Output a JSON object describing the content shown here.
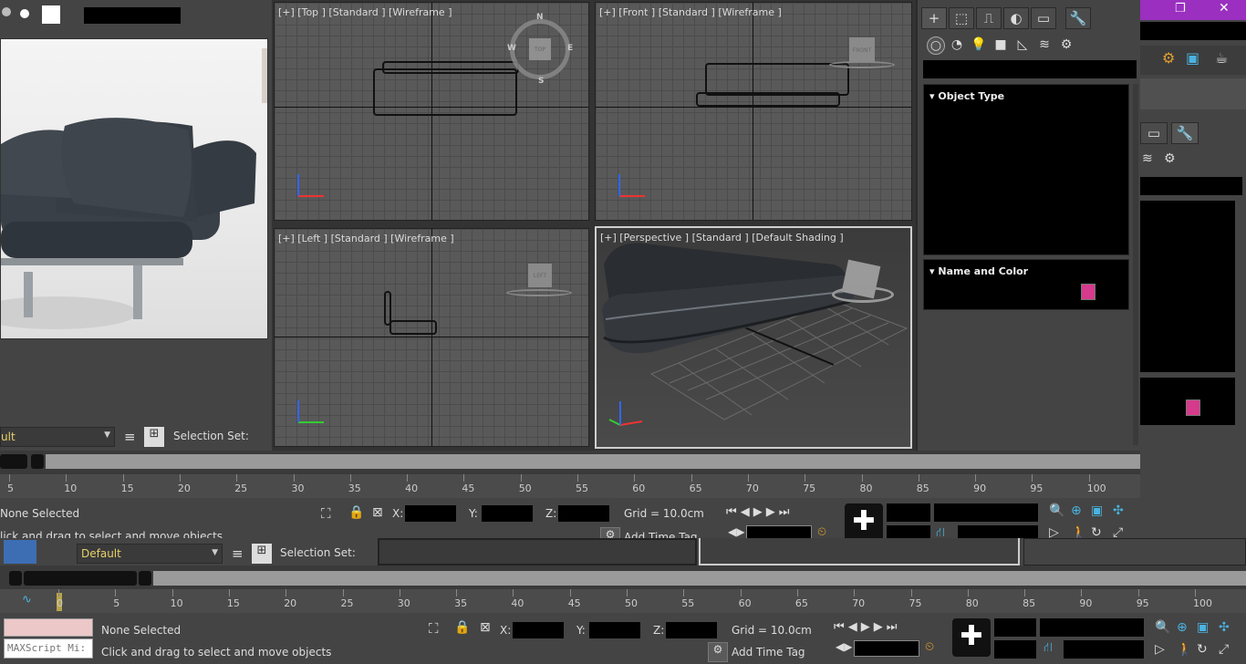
{
  "window": {
    "restore_label": "❐",
    "close_label": "✕"
  },
  "viewports": {
    "top": {
      "label": "[+] [Top ] [Standard ] [Wireframe ]",
      "nav": {
        "n": "N",
        "s": "S",
        "e": "E",
        "w": "W",
        "face": "TOP"
      }
    },
    "front": {
      "label": "[+] [Front ] [Standard ] [Wireframe ]",
      "cube": "FRONT"
    },
    "left": {
      "label": "[+] [Left ] [Standard ] [Wireframe ]",
      "cube": "LEFT"
    },
    "perspective": {
      "label": "[+] [Perspective ] [Standard ] [Default Shading ]"
    }
  },
  "command_panel": {
    "tabs": [
      "+",
      "⬚",
      "⎍",
      "◐",
      "▭",
      "🔧"
    ],
    "subtabs": [
      "○",
      "◔",
      "💡",
      "■",
      "◺",
      "≋",
      "⚙"
    ],
    "rollouts": {
      "object_type": "Object Type",
      "name_color": "Name and Color"
    },
    "color_swatch": "#d63a8c"
  },
  "ribbon_top": {
    "layer": "ult",
    "selection_set_label": "Selection Set:"
  },
  "timeline_top": {
    "ticks": [
      "5",
      "10",
      "15",
      "20",
      "25",
      "30",
      "35",
      "40",
      "45",
      "50",
      "55",
      "60",
      "65",
      "70",
      "75",
      "80",
      "85",
      "90",
      "95",
      "100"
    ]
  },
  "status_top": {
    "selection": "None Selected",
    "prompt": "lick and drag to select and move objects",
    "x_label": "X:",
    "y_label": "Y:",
    "z_label": "Z:",
    "grid": "Grid = 10.0cm",
    "add_time_tag": "Add Time Tag"
  },
  "ribbon_bottom": {
    "layer": "Default",
    "selection_set_label": "Selection Set:"
  },
  "timeline_bottom": {
    "ticks": [
      "0",
      "5",
      "10",
      "15",
      "20",
      "25",
      "30",
      "35",
      "40",
      "45",
      "50",
      "55",
      "60",
      "65",
      "70",
      "75",
      "80",
      "85",
      "90",
      "95",
      "100"
    ]
  },
  "status_bottom": {
    "maxscript_placeholder": "MAXScript Mi:",
    "selection": "None Selected",
    "prompt": "Click and drag to select and move objects",
    "x_label": "X:",
    "y_label": "Y:",
    "z_label": "Z:",
    "grid": "Grid = 10.0cm",
    "add_time_tag": "Add Time Tag"
  },
  "colors": {
    "accent_purple": "#9a2fc0",
    "swatch": "#d63a8c",
    "viewport_bg": "#5a5a5a"
  }
}
